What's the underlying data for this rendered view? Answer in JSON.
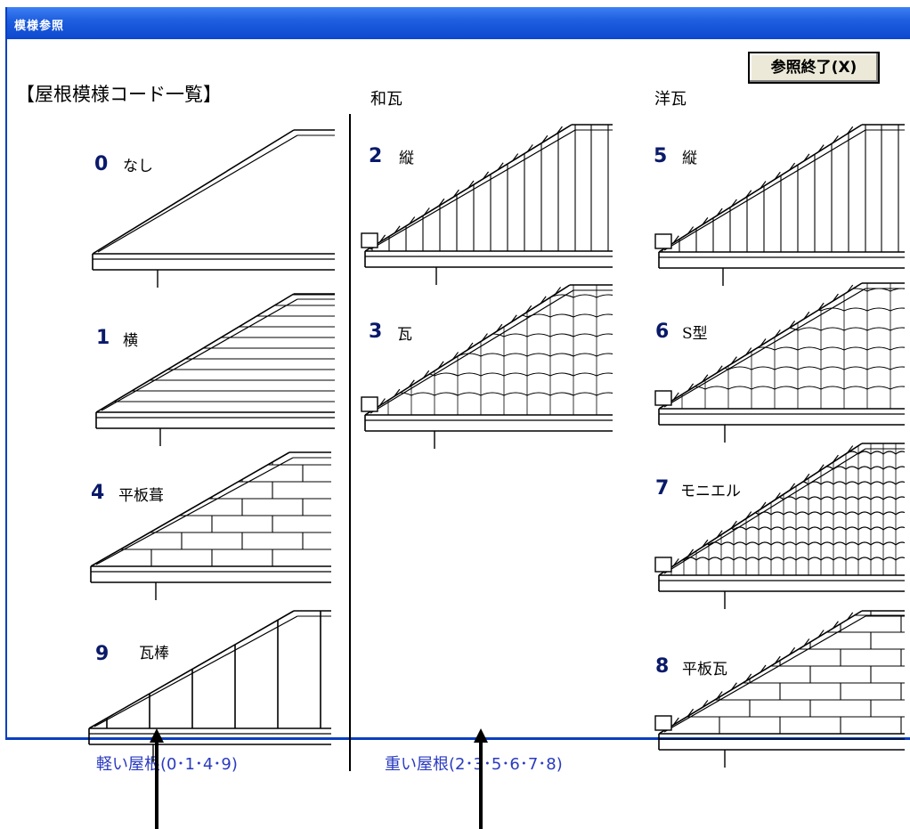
{
  "window": {
    "title": "模様参照"
  },
  "close_button": {
    "label": "参照終了(X)"
  },
  "heading": "【屋根模様コード一覧】",
  "columns": {
    "wagawara": "和瓦",
    "yougawara": "洋瓦"
  },
  "patterns": [
    {
      "code": "0",
      "name": "なし"
    },
    {
      "code": "1",
      "name": "横"
    },
    {
      "code": "4",
      "name": "平板葺"
    },
    {
      "code": "9",
      "name": "瓦棒"
    },
    {
      "code": "2",
      "name": "縦"
    },
    {
      "code": "3",
      "name": "瓦"
    },
    {
      "code": "5",
      "name": "縦"
    },
    {
      "code": "6",
      "name": "S型"
    },
    {
      "code": "7",
      "name": "モニエル"
    },
    {
      "code": "8",
      "name": "平板瓦"
    }
  ],
  "footer": {
    "light": "軽い屋根(0･1･4･9)",
    "heavy": "重い屋根(2･3･5･6･7･8)"
  }
}
